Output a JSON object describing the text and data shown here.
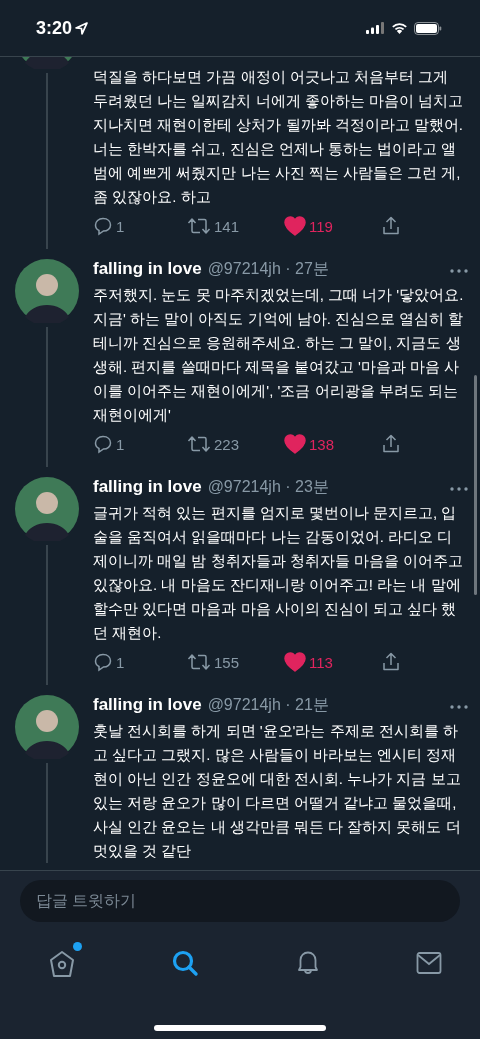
{
  "status_bar": {
    "time": "3:20"
  },
  "tweets": [
    {
      "text": "덕질을 하다보면 가끔 애정이 어긋나고 처음부터 그게 두려웠던 나는 일찌감치 너에게 좋아하는 마음이 넘치고 지나치면 재현이한테 상처가 될까봐 걱정이라고 말했어. 너는 한박자를 쉬고, 진심은 언제나 통하는 법이라고 앨범에 예쁘게 써줬지만 나는 사진 찍는 사람들은 그런 게, 좀 있잖아요. 하고",
      "replies": "1",
      "retweets": "141",
      "likes": "119",
      "liked": true
    },
    {
      "name": "falling in love",
      "handle": "@97214jh",
      "time": "· 27분",
      "text": "주저했지. 눈도 못 마주치겠었는데, 그때 너가 '닿았어요. 지금' 하는 말이 아직도 기억에 남아. 진심으로 열심히 할테니까 진심으로 응원해주세요. 하는 그 말이, 지금도 생생해. 편지를 쓸때마다 제목을 붙여갔고 '마음과 마음 사이를 이어주는 재현이에게', '조금 어리광을 부려도 되는 재현이에게'",
      "replies": "1",
      "retweets": "223",
      "likes": "138",
      "liked": true
    },
    {
      "name": "falling in love",
      "handle": "@97214jh",
      "time": "· 23분",
      "text": "글귀가 적혀 있는 편지를 엄지로 몇번이나 문지르고, 입술을 움직여서 읽을때마다 나는 감동이었어. 라디오 디제이니까 매일 밤 청취자들과 청취자들 마음을 이어주고 있잖아요. 내 마음도 잔디재니랑 이어주고! 라는 내 말에 할수만 있다면 마음과 마음 사이의 진심이 되고 싶다 했던 재현아.",
      "replies": "1",
      "retweets": "155",
      "likes": "113",
      "liked": true
    },
    {
      "name": "falling in love",
      "handle": "@97214jh",
      "time": "· 21분",
      "text": "훗날 전시회를 하게 되면 '윤오'라는 주제로 전시회를 하고 싶다고 그랬지. 많은 사람들이 바라보는 엔시티 정재현이 아닌 인간 정윤오에 대한 전시회. 누나가 지금 보고 있는 저랑 윤오가 많이 다르면 어떨거 같냐고 물었을때, 사실 인간 윤오는 내 생각만큼 뭐든 다 잘하지 못해도 더 멋있을 것 같단"
    }
  ],
  "reply_field": {
    "placeholder": "답글 트윗하기"
  },
  "tab_bar": [
    {
      "kind": "home",
      "selected": false,
      "unread": true
    },
    {
      "kind": "search",
      "selected": true,
      "unread": false
    },
    {
      "kind": "notifications",
      "selected": false,
      "unread": false
    },
    {
      "kind": "messages",
      "selected": false,
      "unread": false
    }
  ]
}
